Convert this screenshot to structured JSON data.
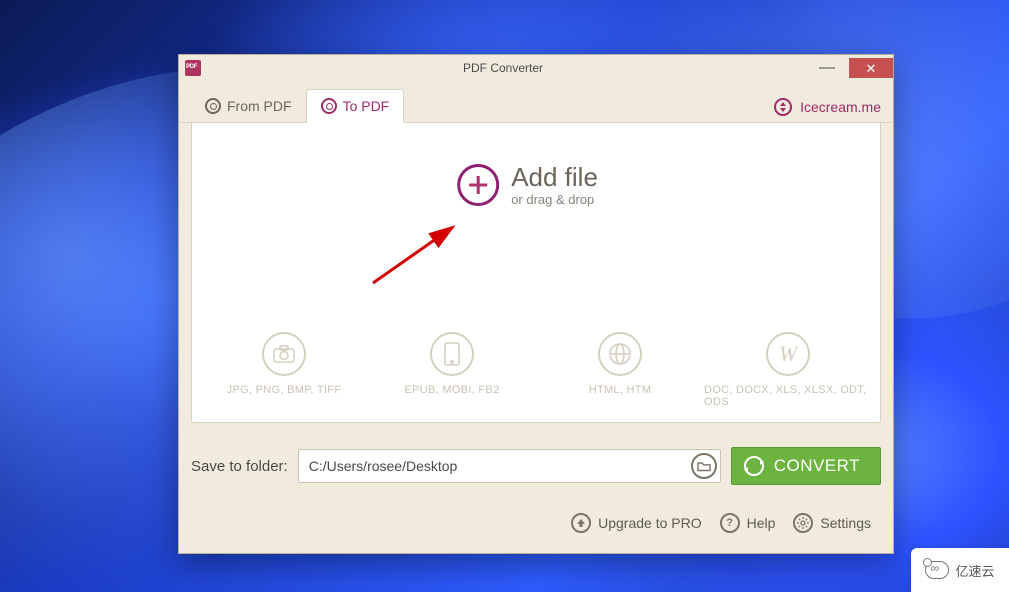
{
  "window": {
    "title": "PDF Converter"
  },
  "tabs": {
    "from": "From PDF",
    "to": "To PDF"
  },
  "brand": {
    "name": "Icecream.me"
  },
  "addfile": {
    "title": "Add file",
    "subtitle": "or drag & drop"
  },
  "types": {
    "img": "JPG, PNG, BMP, TIFF",
    "ebook": "EPUB, MOBI, FB2",
    "html": "HTML, HTM",
    "doc": "DOC, DOCX, XLS, XLSX, ODT, ODS"
  },
  "save": {
    "label": "Save to folder:",
    "path": "C:/Users/rosee/Desktop"
  },
  "convert": {
    "label": "CONVERT"
  },
  "footer": {
    "upgrade": "Upgrade to PRO",
    "help": "Help",
    "settings": "Settings"
  },
  "watermark": "亿速云"
}
